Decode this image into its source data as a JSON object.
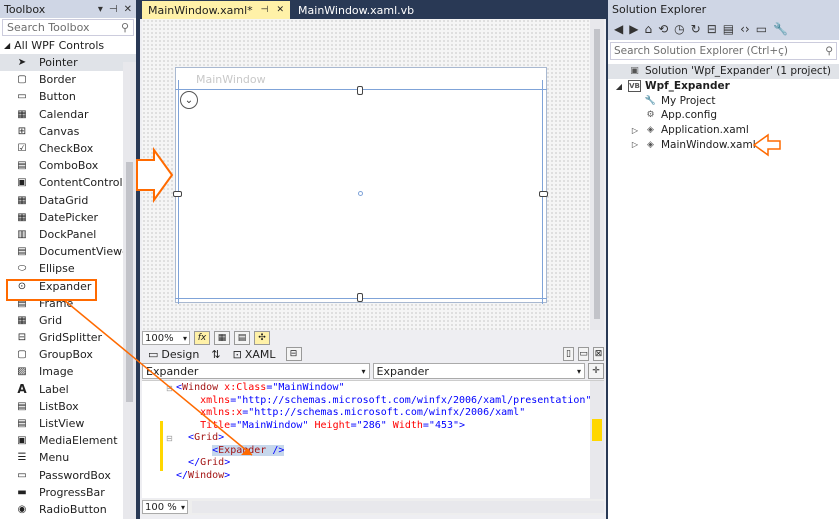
{
  "toolbox": {
    "title": "Toolbox",
    "search_placeholder": "Search Toolbox",
    "group": "All WPF Controls",
    "items": [
      {
        "label": "Pointer",
        "icon": "pointer-icon"
      },
      {
        "label": "Border",
        "icon": "border-icon"
      },
      {
        "label": "Button",
        "icon": "button-icon"
      },
      {
        "label": "Calendar",
        "icon": "calendar-icon"
      },
      {
        "label": "Canvas",
        "icon": "canvas-icon"
      },
      {
        "label": "CheckBox",
        "icon": "checkbox-icon"
      },
      {
        "label": "ComboBox",
        "icon": "combobox-icon"
      },
      {
        "label": "ContentControl",
        "icon": "contentcontrol-icon"
      },
      {
        "label": "DataGrid",
        "icon": "datagrid-icon"
      },
      {
        "label": "DatePicker",
        "icon": "datepicker-icon"
      },
      {
        "label": "DockPanel",
        "icon": "dockpanel-icon"
      },
      {
        "label": "DocumentViewer",
        "icon": "documentviewer-icon"
      },
      {
        "label": "Ellipse",
        "icon": "ellipse-icon"
      },
      {
        "label": "Expander",
        "icon": "expander-icon"
      },
      {
        "label": "Frame",
        "icon": "frame-icon"
      },
      {
        "label": "Grid",
        "icon": "grid-icon"
      },
      {
        "label": "GridSplitter",
        "icon": "gridsplitter-icon"
      },
      {
        "label": "GroupBox",
        "icon": "groupbox-icon"
      },
      {
        "label": "Image",
        "icon": "image-icon"
      },
      {
        "label": "Label",
        "icon": "label-icon"
      },
      {
        "label": "ListBox",
        "icon": "listbox-icon"
      },
      {
        "label": "ListView",
        "icon": "listview-icon"
      },
      {
        "label": "MediaElement",
        "icon": "mediaelement-icon"
      },
      {
        "label": "Menu",
        "icon": "menu-icon"
      },
      {
        "label": "PasswordBox",
        "icon": "passwordbox-icon"
      },
      {
        "label": "ProgressBar",
        "icon": "progressbar-icon"
      },
      {
        "label": "RadioButton",
        "icon": "radiobutton-icon"
      }
    ]
  },
  "tabs": [
    {
      "label": "MainWindow.xaml*",
      "active": true
    },
    {
      "label": "MainWindow.xaml.vb",
      "active": false
    }
  ],
  "designer": {
    "window_title": "MainWindow",
    "zoom": "100%",
    "fx_label": "fx",
    "design_tab": "Design",
    "swap_glyph": "⇅",
    "xaml_tab": "XAML",
    "combo_left": "Expander",
    "combo_right": "Expander",
    "bottom_zoom": "100 %"
  },
  "xaml_lines": [
    {
      "indent": "",
      "parts": [
        [
          "br",
          "<"
        ],
        [
          "tag",
          "Window"
        ],
        [
          "attr",
          " x:Class"
        ],
        [
          "br",
          "=\""
        ],
        [
          "val",
          "MainWindow"
        ],
        [
          "br",
          "\""
        ]
      ]
    },
    {
      "indent": "    ",
      "parts": [
        [
          "attr",
          "xmlns"
        ],
        [
          "br",
          "=\""
        ],
        [
          "val",
          "http://schemas.microsoft.com/winfx/2006/xaml/presentation"
        ],
        [
          "br",
          "\""
        ]
      ]
    },
    {
      "indent": "    ",
      "parts": [
        [
          "attr",
          "xmlns:x"
        ],
        [
          "br",
          "=\""
        ],
        [
          "val",
          "http://schemas.microsoft.com/winfx/2006/xaml"
        ],
        [
          "br",
          "\""
        ]
      ]
    },
    {
      "indent": "    ",
      "parts": [
        [
          "attr",
          "Title"
        ],
        [
          "br",
          "=\""
        ],
        [
          "val",
          "MainWindow"
        ],
        [
          "br",
          "\" "
        ],
        [
          "attr",
          "Height"
        ],
        [
          "br",
          "=\""
        ],
        [
          "val",
          "286"
        ],
        [
          "br",
          "\" "
        ],
        [
          "attr",
          "Width"
        ],
        [
          "br",
          "=\""
        ],
        [
          "val",
          "453"
        ],
        [
          "br",
          "\">"
        ]
      ]
    },
    {
      "indent": "  ",
      "parts": [
        [
          "br",
          "<"
        ],
        [
          "tag",
          "Grid"
        ],
        [
          "br",
          ">"
        ]
      ]
    },
    {
      "indent": "      ",
      "parts": [
        [
          "br",
          "<"
        ],
        [
          "tag",
          "Expander"
        ],
        [
          "br",
          " />"
        ]
      ],
      "highlight": true
    },
    {
      "indent": "  ",
      "parts": [
        [
          "br",
          "</"
        ],
        [
          "tag",
          "Grid"
        ],
        [
          "br",
          ">"
        ]
      ]
    },
    {
      "indent": "",
      "parts": [
        [
          "br",
          "</"
        ],
        [
          "tag",
          "Window"
        ],
        [
          "br",
          ">"
        ]
      ]
    }
  ],
  "solution_explorer": {
    "title": "Solution Explorer",
    "search_placeholder": "Search Solution Explorer (Ctrl+ç)",
    "tree": [
      {
        "label": "Solution 'Wpf_Expander' (1 project)",
        "level": 0,
        "expander": "",
        "icon": "solution-icon",
        "bold": false,
        "selected": true
      },
      {
        "label": "Wpf_Expander",
        "level": 0,
        "expander": "◢",
        "icon": "vb-project-icon",
        "bold": true
      },
      {
        "label": "My Project",
        "level": 1,
        "expander": "",
        "icon": "wrench-icon",
        "bold": false
      },
      {
        "label": "App.config",
        "level": 1,
        "expander": "",
        "icon": "config-icon",
        "bold": false
      },
      {
        "label": "Application.xaml",
        "level": 1,
        "expander": "▷",
        "icon": "xaml-file-icon",
        "bold": false
      },
      {
        "label": "MainWindow.xaml",
        "level": 1,
        "expander": "▷",
        "icon": "xaml-file-icon",
        "bold": false
      }
    ]
  },
  "colors": {
    "accent_orange": "#ff6a00",
    "vs_chrome": "#293955",
    "active_tab": "#fff1a8"
  }
}
